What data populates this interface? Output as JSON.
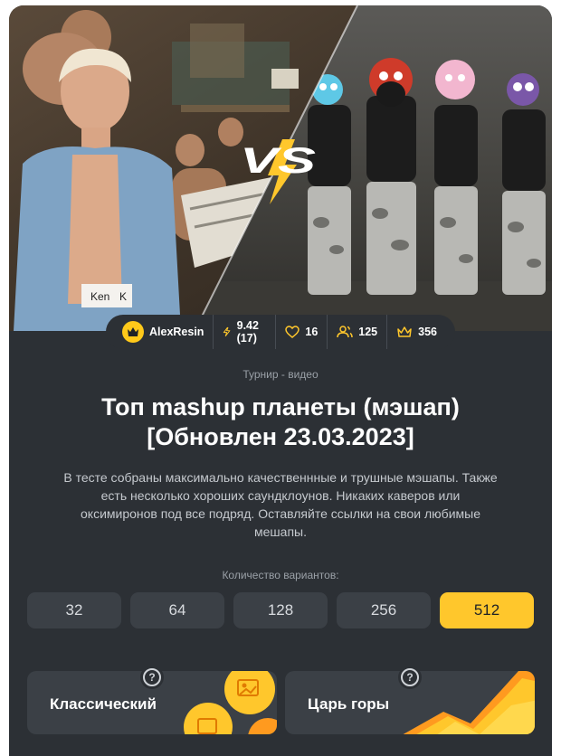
{
  "hero": {
    "vs_text": "VS",
    "shirt_text": "Ken",
    "shirt_letter": "K"
  },
  "stats": {
    "author": "AlexResin",
    "rating": "9.42 (17)",
    "likes": "16",
    "players": "125",
    "wins": "356"
  },
  "quiz": {
    "category": "Турнир - видео",
    "title": "Топ mashup планеты (мэшап) [Обновлен 23.03.2023]",
    "description": "В тесте собраны максимально качественнные и трушные мэшапы. Также есть несколько хороших саундклоунов. Никаких каверов или оксимиронов под все подряд. Оставляйте ссылки на свои любимые мешапы."
  },
  "options": {
    "label": "Количество вариантов:",
    "values": [
      "32",
      "64",
      "128",
      "256",
      "512"
    ],
    "selected": "512"
  },
  "modes": {
    "classic_label": "Классический",
    "king_label": "Царь горы",
    "help_symbol": "?"
  },
  "colors": {
    "accent": "#ffc72c",
    "card_bg": "#2c3035",
    "button_bg": "#3b4046"
  }
}
